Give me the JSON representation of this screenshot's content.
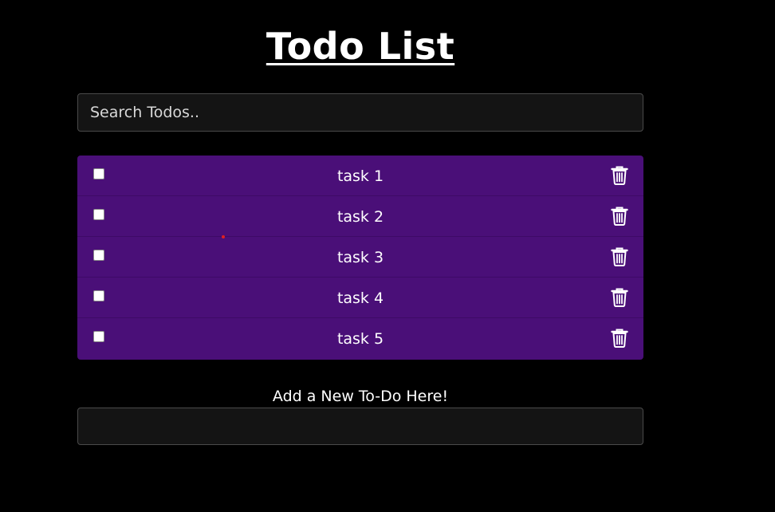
{
  "header": {
    "title": "Todo List"
  },
  "search": {
    "placeholder": "Search Todos..",
    "value": ""
  },
  "todos": [
    {
      "label": "task 1",
      "checked": false,
      "delete_icon": "trash-icon"
    },
    {
      "label": "task 2",
      "checked": false,
      "delete_icon": "trash-icon"
    },
    {
      "label": "task 3",
      "checked": false,
      "delete_icon": "trash-icon"
    },
    {
      "label": "task 4",
      "checked": false,
      "delete_icon": "trash-icon"
    },
    {
      "label": "task 5",
      "checked": false,
      "delete_icon": "trash-icon"
    }
  ],
  "add_form": {
    "label": "Add a New To-Do Here!",
    "value": ""
  },
  "colors": {
    "background": "#000000",
    "list_background": "#4a0f78",
    "input_background": "#141414",
    "text": "#ffffff"
  }
}
